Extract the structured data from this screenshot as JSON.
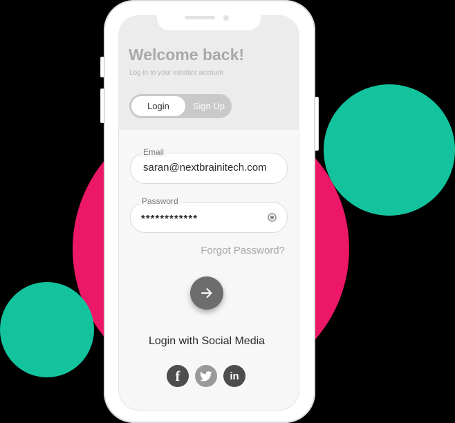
{
  "header": {
    "title": "Welcome back!",
    "subtitle": "Log in to your existant account"
  },
  "toggle": {
    "login_label": "Login",
    "signup_label": "Sign Up",
    "selected": "Login"
  },
  "form": {
    "email_label": "Email",
    "email_value": "saran@nextbrainitech.com",
    "password_label": "Password",
    "password_value": "************",
    "forgot_label": "Forgot Password?"
  },
  "social": {
    "title": "Login with Social Media",
    "icons": [
      "facebook-icon",
      "twitter-icon",
      "linkedin-icon"
    ],
    "facebook_glyph": "f",
    "linkedin_glyph": "in"
  },
  "colors": {
    "pink_blob": "#ec1767",
    "green_blob": "#13c39e",
    "submit_button": "#6d6d6d",
    "header_bg": "#ececec"
  }
}
